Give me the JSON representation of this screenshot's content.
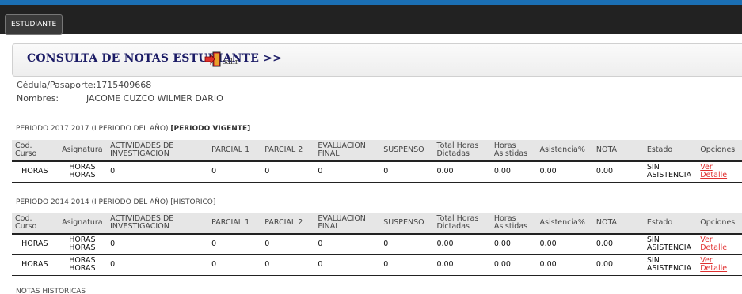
{
  "nav": {
    "estudiante_label": "ESTUDIANTE"
  },
  "header": {
    "title": "CONSULTA DE NOTAS ESTUDIANTE >>",
    "exit_label": "salir"
  },
  "student": {
    "cedula_label": "Cédula/Pasaporte:",
    "cedula_value": "1715409668",
    "nombres_label": "Nombres:",
    "nombres_value": "JACOME CUZCO WILMER DARIO"
  },
  "columns": [
    "Cod. Curso",
    "Asignatura",
    "ACTIVIDADES DE INVESTIGACION",
    "PARCIAL 1",
    "PARCIAL 2",
    "EVALUACION FINAL",
    "SUSPENSO",
    "Total Horas Dictadas",
    "Horas Asistidas",
    "Asistencia%",
    "NOTA",
    "Estado",
    "Opciones"
  ],
  "periods": [
    {
      "label": "PERIODO 2017 2017 (I PERIODO DEL AÑO)",
      "status": "[PERIODO VIGENTE]",
      "rows": [
        [
          "HORAS",
          "HORAS HORAS",
          "0",
          "0",
          "0",
          "0",
          "0",
          "0.00",
          "0.00",
          "0.00",
          "0.00",
          "SIN ASISTENCIA",
          "Ver Detalle"
        ]
      ]
    },
    {
      "label": "PERIODO 2014 2014 (I PERIODO DEL AÑO)",
      "status": "[HISTORICO]",
      "rows": [
        [
          "HORAS",
          "HORAS HORAS",
          "0",
          "0",
          "0",
          "0",
          "0",
          "0.00",
          "0.00",
          "0.00",
          "0.00",
          "SIN ASISTENCIA",
          "Ver Detalle"
        ],
        [
          "HORAS",
          "HORAS HORAS",
          "0",
          "0",
          "0",
          "0",
          "0",
          "0.00",
          "0.00",
          "0.00",
          "0.00",
          "SIN ASISTENCIA",
          "Ver Detalle"
        ]
      ]
    }
  ],
  "footer": {
    "notas_historicas": "NOTAS HISTORICAS"
  }
}
